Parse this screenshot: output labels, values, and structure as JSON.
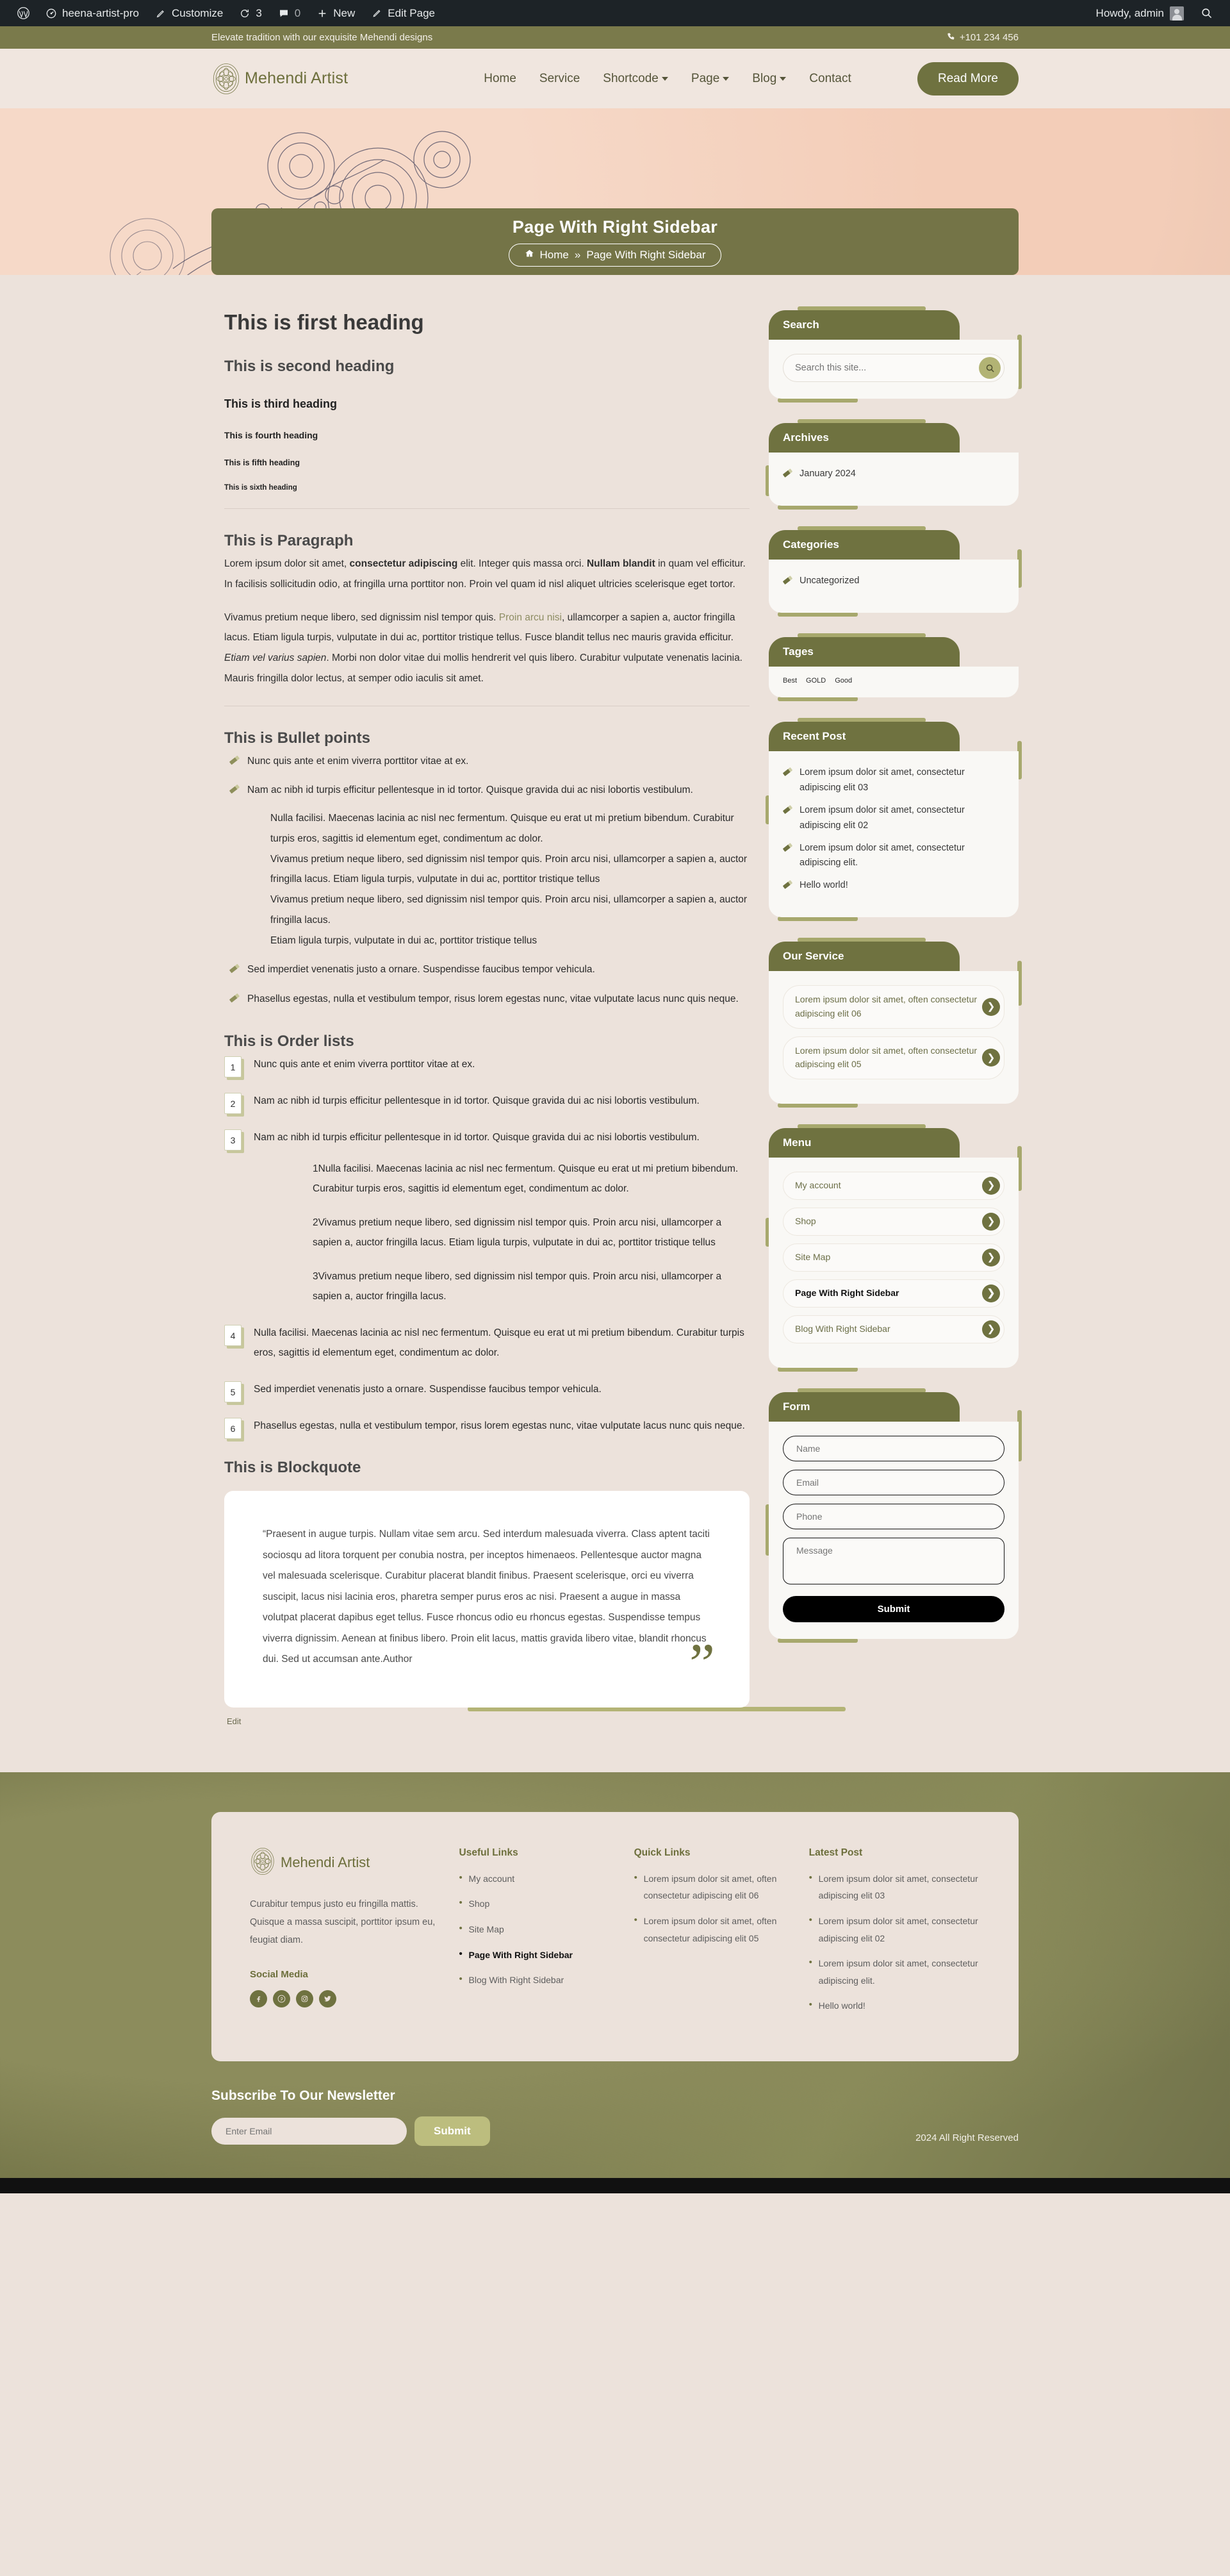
{
  "admin_bar": {
    "wp_icon": "wordpress-icon",
    "site_name": "heena-artist-pro",
    "customize": "Customize",
    "updates_count": "3",
    "comments_count": "0",
    "new": "New",
    "edit_page": "Edit Page",
    "howdy": "Howdy, admin",
    "search_icon": "search-icon"
  },
  "topbar": {
    "tagline": "Elevate tradition with our exquisite Mehendi designs",
    "phone": "+101 234 456"
  },
  "header": {
    "brand": "Mehendi Artist",
    "nav": [
      {
        "label": "Home",
        "caret": false
      },
      {
        "label": "Service",
        "caret": false
      },
      {
        "label": "Shortcode",
        "caret": true
      },
      {
        "label": "Page",
        "caret": true
      },
      {
        "label": "Blog",
        "caret": true
      },
      {
        "label": "Contact",
        "caret": false
      }
    ],
    "cta": "Read More"
  },
  "page_title": {
    "title": "Page With Right Sidebar",
    "crumb_home": "Home",
    "crumb_sep": "»",
    "crumb_current": "Page With Right Sidebar"
  },
  "content": {
    "h1": "This is first heading",
    "h2": "This is second heading",
    "h3": "This is third heading",
    "h4": "This is fourth heading",
    "h5": "This is fifth heading",
    "h6": "This is sixth heading",
    "paragraph_heading": "This is Paragraph",
    "p1_a": "Lorem ipsum dolor sit amet, ",
    "p1_b": "consectetur adipiscing",
    "p1_c": " elit. Integer quis massa orci. ",
    "p1_d": "Nullam blandit",
    "p1_e": " in quam vel efficitur. In facilisis sollicitudin odio, at fringilla urna porttitor non. Proin vel quam id nisl aliquet ultricies scelerisque eget tortor.",
    "p2_a": "Vivamus pretium neque libero, sed dignissim nisl tempor quis. ",
    "p2_link": "Proin arcu nisi",
    "p2_b": ", ullamcorper a sapien a, auctor fringilla lacus. Etiam ligula turpis, vulputate in dui ac, porttitor tristique tellus. Fusce blandit tellus nec mauris gravida efficitur. ",
    "p2_em": "Etiam vel varius sapien",
    "p2_c": ". Morbi non dolor vitae dui mollis hendrerit vel quis libero. Curabitur vulputate venenatis lacinia. Mauris fringilla dolor lectus, at semper odio iaculis sit amet.",
    "bullets_heading": "This is Bullet points",
    "bullets": [
      "Nunc quis ante et enim viverra porttitor vitae at ex.",
      "Nam ac nibh id turpis efficitur pellentesque in id tortor. Quisque gravida dui ac nisi lobortis vestibulum.",
      "Sed imperdiet venenatis justo a ornare. Suspendisse faucibus tempor vehicula.",
      "Phasellus egestas, nulla et vestibulum tempor, risus lorem egestas nunc, vitae vulputate lacus nunc quis neque."
    ],
    "bullets_nested": [
      "Nulla facilisi. Maecenas lacinia ac nisl nec fermentum. Quisque eu erat ut mi pretium bibendum. Curabitur turpis eros, sagittis id elementum eget, condimentum ac dolor.",
      "Vivamus pretium neque libero, sed dignissim nisl tempor quis. Proin arcu nisi, ullamcorper a sapien a, auctor fringilla lacus. Etiam ligula turpis, vulputate in dui ac, porttitor tristique tellus",
      "Vivamus pretium neque libero, sed dignissim nisl tempor quis. Proin arcu nisi, ullamcorper a sapien a, auctor fringilla lacus.",
      "Etiam ligula turpis, vulputate in dui ac, porttitor tristique tellus"
    ],
    "orders_heading": "This is Order lists",
    "orders": [
      "Nunc quis ante et enim viverra porttitor vitae at ex.",
      "Nam ac nibh id turpis efficitur pellentesque in id tortor. Quisque gravida dui ac nisi lobortis vestibulum.",
      "Nam ac nibh id turpis efficitur pellentesque in id tortor. Quisque gravida dui ac nisi lobortis vestibulum.",
      "Nulla facilisi. Maecenas lacinia ac nisl nec fermentum. Quisque eu erat ut mi pretium bibendum. Curabitur turpis eros, sagittis id elementum eget, condimentum ac dolor.",
      "Sed imperdiet venenatis justo a ornare. Suspendisse faucibus tempor vehicula.",
      "Phasellus egestas, nulla et vestibulum tempor, risus lorem egestas nunc, vitae vulputate lacus nunc quis neque."
    ],
    "orders_nested": [
      "Nulla facilisi. Maecenas lacinia ac nisl nec fermentum. Quisque eu erat ut mi pretium bibendum. Curabitur turpis eros, sagittis id elementum eget, condimentum ac dolor.",
      "Vivamus pretium neque libero, sed dignissim nisl tempor quis. Proin arcu nisi, ullamcorper a sapien a, auctor fringilla lacus. Etiam ligula turpis, vulputate in dui ac, porttitor tristique tellus",
      "Vivamus pretium neque libero, sed dignissim nisl tempor quis. Proin arcu nisi, ullamcorper a sapien a, auctor fringilla lacus."
    ],
    "blockquote_heading": "This is Blockquote",
    "blockquote_text": "“Praesent in augue turpis. Nullam vitae sem arcu. Sed interdum malesuada viverra. Class aptent taciti sociosqu ad litora torquent per conubia nostra, per inceptos himenaeos. Pellentesque auctor magna vel malesuada scelerisque. Curabitur placerat blandit finibus. Praesent scelerisque, orci eu viverra suscipit, lacus nisi lacinia eros, pharetra semper purus eros ac nisi. Praesent a augue in massa volutpat placerat dapibus eget tellus. Fusce rhoncus odio eu rhoncus egestas. Suspendisse tempus viverra dignissim. Aenean at finibus libero. Proin elit lacus, mattis gravida libero vitae, blandit rhoncus dui. Sed ut accumsan ante.Author",
    "quote_mark": "”",
    "edit_link": "Edit"
  },
  "sidebar": {
    "search": {
      "title": "Search",
      "placeholder": "Search this site...",
      "value": "",
      "button_icon": "search-icon"
    },
    "archives": {
      "title": "Archives",
      "items": [
        "January 2024"
      ]
    },
    "categories": {
      "title": "Categories",
      "items": [
        "Uncategorized"
      ]
    },
    "tags": {
      "title": "Tages",
      "items": [
        "Best",
        "GOLD",
        "Good"
      ]
    },
    "recent_post": {
      "title": "Recent Post",
      "items": [
        "Lorem ipsum dolor sit amet, consectetur adipiscing elit 03",
        "Lorem ipsum dolor sit amet, consectetur adipiscing elit 02",
        "Lorem ipsum dolor sit amet, consectetur adipiscing elit.",
        "Hello world!"
      ]
    },
    "our_service": {
      "title": "Our Service",
      "items": [
        "Lorem ipsum dolor sit amet, often consectetur adipiscing elit 06",
        "Lorem ipsum dolor sit amet, often consectetur adipiscing elit 05"
      ]
    },
    "menu": {
      "title": "Menu",
      "items": [
        {
          "label": "My account",
          "active": false
        },
        {
          "label": "Shop",
          "active": false
        },
        {
          "label": "Site Map",
          "active": false
        },
        {
          "label": "Page With Right Sidebar",
          "active": true
        },
        {
          "label": "Blog With Right Sidebar",
          "active": false
        }
      ]
    },
    "form": {
      "title": "Form",
      "name_placeholder": "Name",
      "email_placeholder": "Email",
      "phone_placeholder": "Phone",
      "message_placeholder": "Message",
      "submit": "Submit"
    }
  },
  "footer": {
    "brand": "Mehendi Artist",
    "description": "Curabitur tempus justo eu fringilla mattis. Quisque a massa suscipit, porttitor ipsum eu, feugiat diam.",
    "social_heading": "Social Media",
    "social": [
      "facebook-icon",
      "pinterest-icon",
      "instagram-icon",
      "twitter-icon"
    ],
    "useful_links": {
      "heading": "Useful Links",
      "items": [
        {
          "label": "My account",
          "active": false
        },
        {
          "label": "Shop",
          "active": false
        },
        {
          "label": "Site Map",
          "active": false
        },
        {
          "label": "Page With Right Sidebar",
          "active": true
        },
        {
          "label": "Blog With Right Sidebar",
          "active": false
        }
      ]
    },
    "quick_links": {
      "heading": "Quick Links",
      "items": [
        "Lorem ipsum dolor sit amet, often consectetur adipiscing elit 06",
        "Lorem ipsum dolor sit amet, often consectetur adipiscing elit 05"
      ]
    },
    "latest_post": {
      "heading": "Latest Post",
      "items": [
        "Lorem ipsum dolor sit amet, consectetur adipiscing elit 03",
        "Lorem ipsum dolor sit amet, consectetur adipiscing elit 02",
        "Lorem ipsum dolor sit amet, consectetur adipiscing elit.",
        "Hello world!"
      ]
    },
    "newsletter": {
      "heading": "Subscribe To Our Newsletter",
      "placeholder": "Enter Email",
      "submit": "Submit"
    },
    "copyright": "2024 All Right Reserved"
  },
  "colors": {
    "olive": "#6f7240",
    "olive_light": "#a7a86d",
    "bg": "#ece2db",
    "admin": "#1d2327"
  }
}
